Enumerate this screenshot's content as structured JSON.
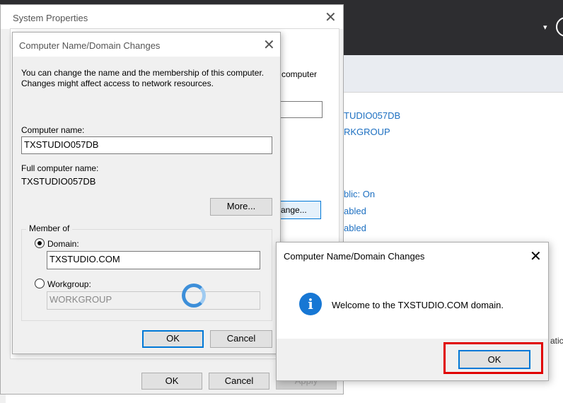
{
  "background": {
    "server_manager": {
      "right_values": {
        "computer_name": "TUDIO057DB",
        "workgroup": "RKGROUP",
        "firewall": "blic: On",
        "remote_mgmt": "abled",
        "remote_desktop": "abled",
        "tail": "atic"
      }
    }
  },
  "system_properties": {
    "title": "System Properties",
    "partial_text": "computer",
    "change_button": "ange...",
    "buttons": {
      "ok": "OK",
      "cancel": "Cancel",
      "apply": "Apply"
    }
  },
  "computer_name_dialog": {
    "title": "Computer Name/Domain Changes",
    "description": "You can change the name and the membership of this computer. Changes might affect access to network resources.",
    "computer_name_label": "Computer name:",
    "computer_name_value": "TXSTUDIO057DB",
    "full_name_label": "Full computer name:",
    "full_name_value": "TXSTUDIO057DB",
    "more_button": "More...",
    "member_of_label": "Member of",
    "domain_label": "Domain:",
    "domain_value": "TXSTUDIO.COM",
    "domain_selected": true,
    "workgroup_label": "Workgroup:",
    "workgroup_value": "WORKGROUP",
    "buttons": {
      "ok": "OK",
      "cancel": "Cancel"
    }
  },
  "welcome_dialog": {
    "title": "Computer Name/Domain Changes",
    "message": "Welcome to the TXSTUDIO.COM domain.",
    "icon": "info-icon",
    "ok_button": "OK",
    "highlight_color": "#e00000"
  }
}
